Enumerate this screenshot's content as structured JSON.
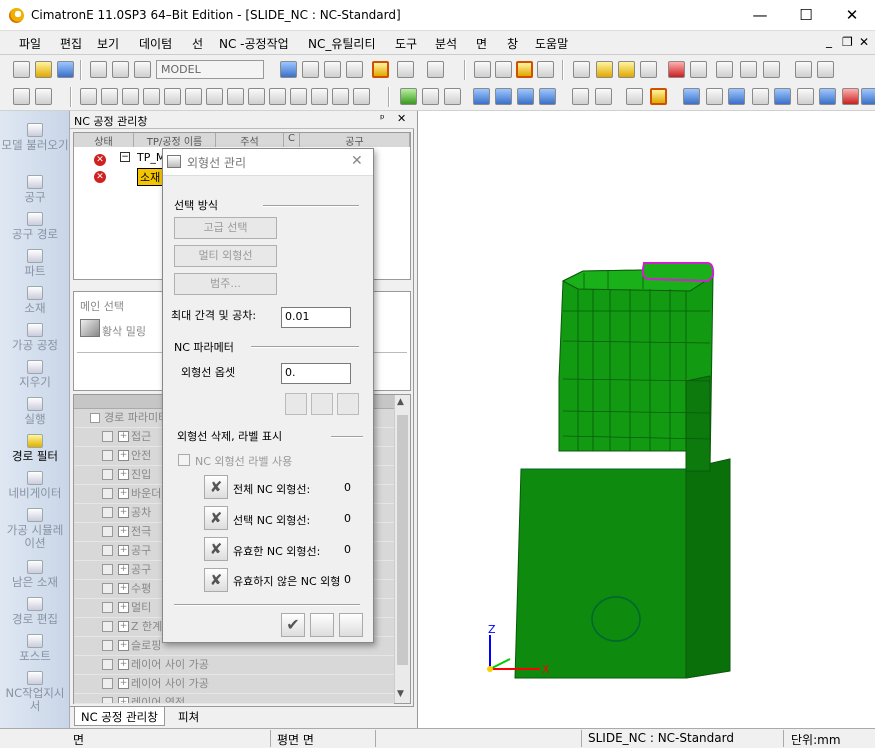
{
  "window": {
    "title": "CimatronE 11.0SP3 64–Bit Edition - [SLIDE_NC : NC-Standard]",
    "minimize": "—",
    "maximize": "☐",
    "close": "✕",
    "mdi_minimize": "_",
    "mdi_restore": "❐",
    "mdi_close": "✕"
  },
  "menu": [
    "파일",
    "편집",
    "보기",
    "데이텀",
    "선",
    "NC -공정작업",
    "NC_유틸리티",
    "도구",
    "분석",
    "면",
    "창",
    "도움말"
  ],
  "toolbar": {
    "model_select": "MODEL"
  },
  "left_bar": [
    {
      "label": "모델 불러오기",
      "icon": "load-model-icon"
    },
    {
      "label": "공구",
      "icon": "tool-icon"
    },
    {
      "label": "공구 경로",
      "icon": "toolpath-icon"
    },
    {
      "label": "파트",
      "icon": "part-icon"
    },
    {
      "label": "소재",
      "icon": "stock-icon"
    },
    {
      "label": "가공 공정",
      "icon": "procedure-icon"
    },
    {
      "label": "지우기",
      "icon": "erase-icon"
    },
    {
      "label": "실행",
      "icon": "run-icon"
    },
    {
      "label": "경로 필터",
      "icon": "path-filter-icon"
    },
    {
      "label": "네비게이터",
      "icon": "navigator-icon"
    },
    {
      "label": "가공 시뮬레이션",
      "icon": "simulation-icon"
    },
    {
      "label": "남은 소재",
      "icon": "remaining-stock-icon"
    },
    {
      "label": "경로 편집",
      "icon": "path-edit-icon"
    },
    {
      "label": "포스트",
      "icon": "post-icon"
    },
    {
      "label": "NC작업지시서",
      "icon": "nc-sheet-icon"
    }
  ],
  "nc_panel": {
    "title": "NC 공정 관리창",
    "pin": "ᵖ",
    "close": "✕",
    "columns": [
      "상태",
      "TP/공정 이름",
      "주석",
      "C",
      "공구"
    ],
    "tree": [
      {
        "name": "TP_M",
        "status": "x"
      },
      {
        "name": "소재",
        "status": "x"
      }
    ],
    "main_select_label": "메인 선택",
    "main_select_item": "황삭 밀링",
    "process_rows": [
      "경로 파라미터",
      "접근",
      "안전",
      "진입",
      "바운더리",
      "공차",
      "전극",
      "공구",
      "공구",
      "수평",
      "멀티",
      "Z 한계",
      "슬로핑",
      "레이어 사이 가공",
      "레이어 사이 가공",
      "레이어 역전"
    ],
    "tabs": [
      "NC 공정 관리창",
      "피쳐"
    ]
  },
  "dialog": {
    "title": "외형선 관리",
    "close": "✕",
    "section_select": "선택 방식",
    "btn_advanced": "고급 선택",
    "btn_multi": "멀티 외형선",
    "btn_range": "범주...",
    "gap_label": "최대 간격 및 공차:",
    "gap_value": "0.01",
    "section_nc": "NC 파라메터",
    "offset_label": "외형선 옵셋",
    "offset_value": "0.",
    "section_delete": "외형선 삭제, 라벨 표시",
    "checkbox_label": "NC 외형선 라벨 사용",
    "rows": [
      {
        "label": "전체 NC 외형선:",
        "value": "0"
      },
      {
        "label": "선택 NC 외형선:",
        "value": "0"
      },
      {
        "label": "유효한 NC 외형선:",
        "value": "0"
      },
      {
        "label": "유효하지 않은 NC 외형선:",
        "value": "0"
      }
    ]
  },
  "status": {
    "left": "면",
    "mid": "평면 면",
    "doc": "SLIDE_NC : NC-Standard",
    "unit": "단위:mm"
  },
  "axis_labels": {
    "z": "Z",
    "x": "X"
  }
}
